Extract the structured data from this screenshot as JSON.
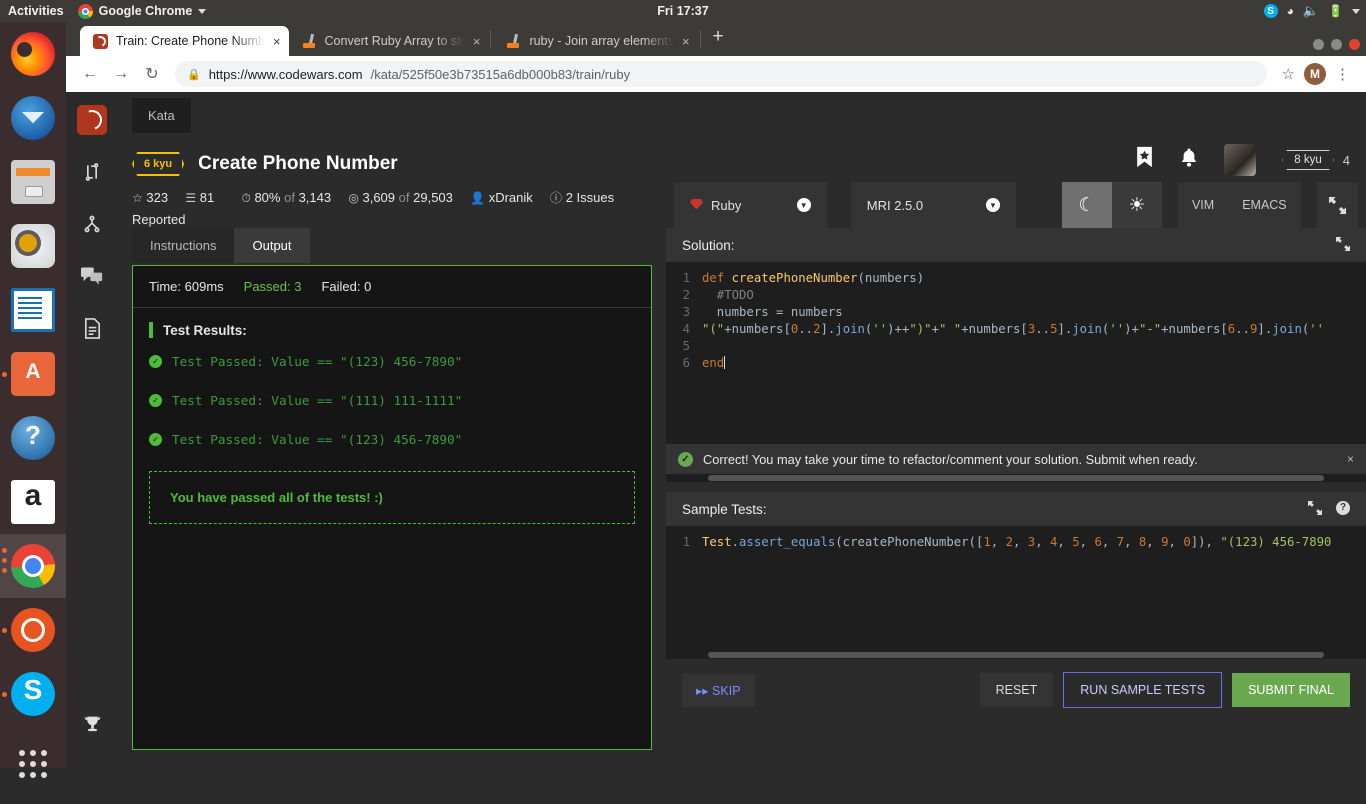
{
  "gnome": {
    "activities": "Activities",
    "app_name": "Google Chrome",
    "clock": "Fri 17:37",
    "tray": [
      "skype-tray-icon",
      "wifi-icon",
      "volume-icon",
      "battery-icon",
      "dropdown-arrow-icon"
    ]
  },
  "dock": {
    "items": [
      {
        "name": "firefox",
        "label": "Firefox"
      },
      {
        "name": "thunderbird",
        "label": "Thunderbird"
      },
      {
        "name": "files",
        "label": "Files"
      },
      {
        "name": "rhythmbox",
        "label": "Rhythmbox"
      },
      {
        "name": "libreoffice-writer",
        "label": "LibreOffice Writer"
      },
      {
        "name": "ubuntu-software",
        "label": "Ubuntu Software"
      },
      {
        "name": "help",
        "label": "Help"
      },
      {
        "name": "amazon",
        "label": "Amazon"
      },
      {
        "name": "google-chrome",
        "label": "Google Chrome"
      },
      {
        "name": "ubuntu",
        "label": "Ubuntu"
      },
      {
        "name": "skype",
        "label": "Skype"
      },
      {
        "name": "show-applications",
        "label": "Show Applications"
      }
    ]
  },
  "browser": {
    "tabs": [
      {
        "title": "Train: Create Phone Numb",
        "favicon": "codewars-icon",
        "active": true
      },
      {
        "title": "Convert Ruby Array to str",
        "favicon": "stackoverflow-icon",
        "active": false
      },
      {
        "title": "ruby - Join array elements",
        "favicon": "stackoverflow-icon",
        "active": false
      }
    ],
    "new_tab_label": "+",
    "close_label": "×",
    "url_domain": "https://www.codewars.com",
    "url_path": "/kata/525f50e3b73515a6db000b83/train/ruby",
    "lock_icon": "🔒",
    "back_icon": "←",
    "forward_icon": "→",
    "reload_icon": "↻",
    "star_icon": "☆",
    "profile_initial": "M",
    "menu_icon": "⋮"
  },
  "rail": {
    "items": [
      {
        "name": "codewars-logo",
        "glyph": ""
      },
      {
        "name": "shuffle-icon",
        "glyph": "⇅"
      },
      {
        "name": "fork-icon",
        "glyph": "⑂"
      },
      {
        "name": "discussion-icon",
        "glyph": "☷"
      },
      {
        "name": "document-icon",
        "glyph": "☰"
      },
      {
        "name": "trophy-icon",
        "glyph": "♜"
      }
    ]
  },
  "kata": {
    "chip": "Kata",
    "rank": "6 kyu",
    "title": "Create Phone Number",
    "stars": "323",
    "stars_icon": "☆",
    "layers": "81",
    "layers_icon": "☰",
    "satisfaction": "80%",
    "satisfaction_of": "of",
    "satisfaction_total": "3,143",
    "completed": "3,609",
    "completed_of": "of",
    "completed_total": "29,503",
    "author": "xDranik",
    "issues_count": "2",
    "issues_label": "Issues Reported"
  },
  "header": {
    "bookmark_icon": "🔖",
    "bell_icon": "🔔",
    "avatar": "user-avatar",
    "user_rank": "8 kyu",
    "honor": "4"
  },
  "toolbar": {
    "language": "Ruby",
    "runtime": "MRI 2.5.0",
    "dark_icon": "☾",
    "light_icon": "☀",
    "vim_label": "VIM",
    "emacs_label": "EMACS",
    "fullscreen_icon": "⛶"
  },
  "left_panel": {
    "tabs": [
      {
        "label": "Instructions",
        "selected": false
      },
      {
        "label": "Output",
        "selected": true
      }
    ],
    "time_label": "Time: 609ms",
    "passed_label": "Passed: 3",
    "failed_label": "Failed: 0",
    "results_heading": "Test Results:",
    "tests": [
      "Test Passed: Value == \"(123) 456-7890\"",
      "Test Passed: Value == \"(111) 111-1111\"",
      "Test Passed: Value == \"(123) 456-7890\""
    ],
    "summary": "You have passed all of the tests! :)"
  },
  "solution": {
    "heading": "Solution:",
    "fullscreen_icon": "⛶",
    "lines": [
      {
        "n": "1",
        "parts": [
          {
            "t": "def ",
            "c": "kw"
          },
          {
            "t": "createPhoneNumber",
            "c": "fn"
          },
          {
            "t": "(numbers)",
            "c": "pn"
          }
        ]
      },
      {
        "n": "2",
        "parts": [
          {
            "t": "  #TODO",
            "c": "cm"
          }
        ]
      },
      {
        "n": "3",
        "parts": [
          {
            "t": "  numbers = numbers",
            "c": "pl"
          }
        ]
      },
      {
        "n": "4",
        "parts": [
          {
            "t": "\"(\"",
            "c": "st"
          },
          {
            "t": "+numbers[",
            "c": "pl"
          },
          {
            "t": "0",
            "c": "num"
          },
          {
            "t": "..",
            "c": "pl"
          },
          {
            "t": "2",
            "c": "num"
          },
          {
            "t": "].",
            "c": "pl"
          },
          {
            "t": "join",
            "c": "mth"
          },
          {
            "t": "(",
            "c": "pl"
          },
          {
            "t": "''",
            "c": "st"
          },
          {
            "t": ")++",
            "c": "pl"
          },
          {
            "t": "\")\"",
            "c": "st"
          },
          {
            "t": "+",
            "c": "pl"
          },
          {
            "t": "\" \"",
            "c": "st"
          },
          {
            "t": "+numbers[",
            "c": "pl"
          },
          {
            "t": "3",
            "c": "num"
          },
          {
            "t": "..",
            "c": "pl"
          },
          {
            "t": "5",
            "c": "num"
          },
          {
            "t": "].",
            "c": "pl"
          },
          {
            "t": "join",
            "c": "mth"
          },
          {
            "t": "(",
            "c": "pl"
          },
          {
            "t": "''",
            "c": "st"
          },
          {
            "t": ")+",
            "c": "pl"
          },
          {
            "t": "\"-\"",
            "c": "st"
          },
          {
            "t": "+numbers[",
            "c": "pl"
          },
          {
            "t": "6",
            "c": "num"
          },
          {
            "t": "..",
            "c": "pl"
          },
          {
            "t": "9",
            "c": "num"
          },
          {
            "t": "].",
            "c": "pl"
          },
          {
            "t": "join",
            "c": "mth"
          },
          {
            "t": "(",
            "c": "pl"
          },
          {
            "t": "''",
            "c": "st"
          }
        ]
      },
      {
        "n": "5",
        "parts": []
      },
      {
        "n": "6",
        "parts": [
          {
            "t": "end",
            "c": "kw"
          }
        ]
      }
    ]
  },
  "notice": {
    "text": "Correct! You may take your time to refactor/comment your solution. Submit when ready.",
    "close": "×",
    "check_icon": "✓"
  },
  "sample_tests": {
    "heading": "Sample Tests:",
    "fullscreen_icon": "⛶",
    "help_icon": "?",
    "lines": [
      {
        "n": "1",
        "parts": [
          {
            "t": "Test",
            "c": "fn"
          },
          {
            "t": ".",
            "c": "pl"
          },
          {
            "t": "assert_equals",
            "c": "mth"
          },
          {
            "t": "(createPhoneNumber([",
            "c": "pl"
          },
          {
            "t": "1",
            "c": "num"
          },
          {
            "t": ", ",
            "c": "pl"
          },
          {
            "t": "2",
            "c": "num"
          },
          {
            "t": ", ",
            "c": "pl"
          },
          {
            "t": "3",
            "c": "num"
          },
          {
            "t": ", ",
            "c": "pl"
          },
          {
            "t": "4",
            "c": "num"
          },
          {
            "t": ", ",
            "c": "pl"
          },
          {
            "t": "5",
            "c": "num"
          },
          {
            "t": ", ",
            "c": "pl"
          },
          {
            "t": "6",
            "c": "num"
          },
          {
            "t": ", ",
            "c": "pl"
          },
          {
            "t": "7",
            "c": "num"
          },
          {
            "t": ", ",
            "c": "pl"
          },
          {
            "t": "8",
            "c": "num"
          },
          {
            "t": ", ",
            "c": "pl"
          },
          {
            "t": "9",
            "c": "num"
          },
          {
            "t": ", ",
            "c": "pl"
          },
          {
            "t": "0",
            "c": "num"
          },
          {
            "t": "]), ",
            "c": "pl"
          },
          {
            "t": "\"(123) 456-7890",
            "c": "st"
          }
        ]
      }
    ]
  },
  "footer": {
    "skip_label": "SKIP",
    "skip_icon": "▸▸",
    "reset_label": "RESET",
    "run_label": "RUN SAMPLE TESTS",
    "submit_label": "SUBMIT FINAL"
  },
  "colors": {
    "pass_green": "#4fbb3a",
    "submit_green": "#6aa84f",
    "kyu_yellow": "#f0c300",
    "codewars_red": "#b1361e"
  }
}
